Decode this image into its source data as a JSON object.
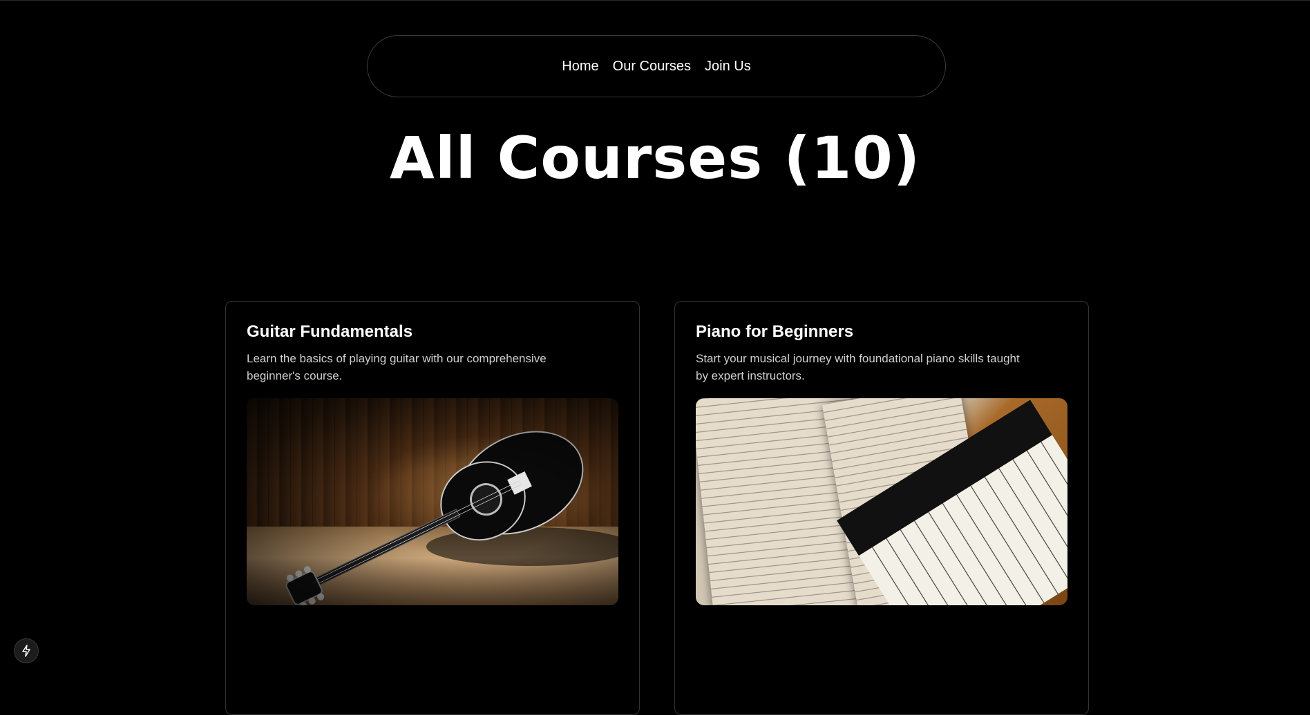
{
  "nav": {
    "links": [
      "Home",
      "Our Courses",
      "Join Us"
    ]
  },
  "page": {
    "title": "All Courses (10)"
  },
  "courses": [
    {
      "title": "Guitar Fundamentals",
      "description": "Learn the basics of playing guitar with our comprehensive beginner's course.",
      "image_icon": "guitar-image"
    },
    {
      "title": "Piano for Beginners",
      "description": "Start your musical journey with foundational piano skills taught by expert instructors.",
      "image_icon": "piano-image"
    }
  ],
  "floating_button": {
    "icon": "lightning-bolt-icon"
  },
  "colors": {
    "background": "#000000",
    "text": "#ffffff",
    "muted_text": "#cfcfcf",
    "border": "#333333"
  }
}
